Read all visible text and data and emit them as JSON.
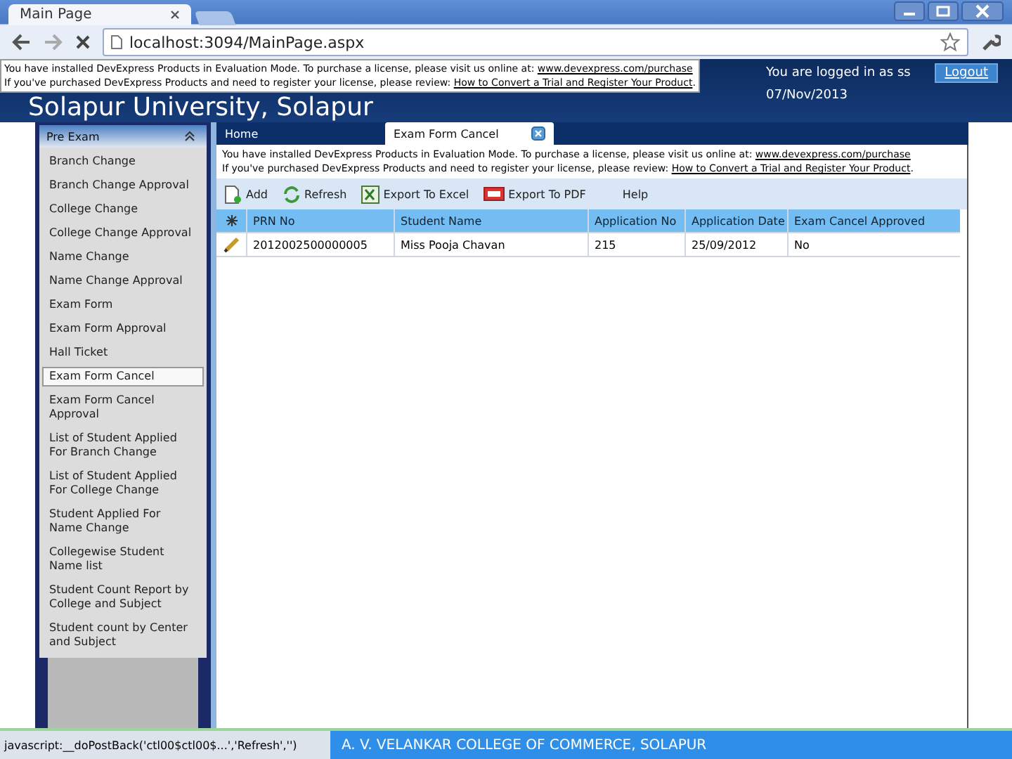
{
  "browser": {
    "tab_title": "Main Page",
    "url": "localhost:3094/MainPage.aspx",
    "status_text": "javascript:__doPostBack('ctl00$ctl00$...','Refresh','')"
  },
  "top_notice": {
    "lines": [
      {
        "text": "You have installed DevExpress Products in Evaluation Mode. To purchase a license, please visit us online at: ",
        "link": "www.devexpress.com/purchase"
      },
      {
        "text": "If you've purchased DevExpress Products and need to register your license, please review: ",
        "link": "How to Convert a Trial and Register Your Product",
        "after": "."
      }
    ]
  },
  "header": {
    "title": "Solapur University, Solapur",
    "user_text": "You are logged in as ss",
    "logout": "Logout",
    "date": "07/Nov/2013"
  },
  "sidebar": {
    "title": "Pre Exam",
    "items": [
      {
        "label": "Branch Change",
        "selected": false
      },
      {
        "label": "Branch Change Approval",
        "selected": false
      },
      {
        "label": "College Change",
        "selected": false
      },
      {
        "label": "College Change Approval",
        "selected": false
      },
      {
        "label": "Name Change",
        "selected": false
      },
      {
        "label": "Name Change Approval",
        "selected": false
      },
      {
        "label": "Exam Form",
        "selected": false
      },
      {
        "label": "Exam Form Approval",
        "selected": false
      },
      {
        "label": "Hall Ticket",
        "selected": false
      },
      {
        "label": "Exam Form Cancel",
        "selected": true
      },
      {
        "label": "Exam Form Cancel Approval",
        "selected": false
      },
      {
        "label": "List of Student Applied For Branch Change",
        "selected": false
      },
      {
        "label": "List of Student Applied For College Change",
        "selected": false
      },
      {
        "label": "Student Applied For Name Change",
        "selected": false
      },
      {
        "label": "Collegewise Student Name list",
        "selected": false
      },
      {
        "label": "Student Count Report by College and Subject",
        "selected": false
      },
      {
        "label": "Student count by Center and Subject",
        "selected": false
      }
    ]
  },
  "tabs": [
    {
      "label": "Home",
      "selected": false
    },
    {
      "label": "Exam Form Cancel",
      "selected": true
    }
  ],
  "content_notice": {
    "lines": [
      {
        "text": "You have installed DevExpress Products in Evaluation Mode. To purchase a license, please visit us online at: ",
        "link": "www.devexpress.com/purchase"
      },
      {
        "text": "If you've purchased DevExpress Products and need to register your license, please review: ",
        "link": "How to Convert a Trial and Register Your Product",
        "after": "."
      }
    ]
  },
  "toolbar": [
    {
      "kind": "add",
      "label": "Add"
    },
    {
      "kind": "refresh",
      "label": "Refresh"
    },
    {
      "kind": "excel",
      "label": "Export To Excel"
    },
    {
      "kind": "pdf",
      "label": "Export To PDF"
    },
    {
      "kind": "help",
      "label": "Help"
    }
  ],
  "table": {
    "columns": [
      "PRN No",
      "Student Name",
      "Application No",
      "Application Date",
      "Exam Cancel Approved"
    ],
    "rows": [
      [
        "2012002500000005",
        "Miss Pooja Chavan",
        "215",
        "25/09/2012",
        "No"
      ]
    ]
  },
  "footer": {
    "text": "A. V. VELANKAR COLLEGE OF COMMERCE, SOLAPUR"
  }
}
